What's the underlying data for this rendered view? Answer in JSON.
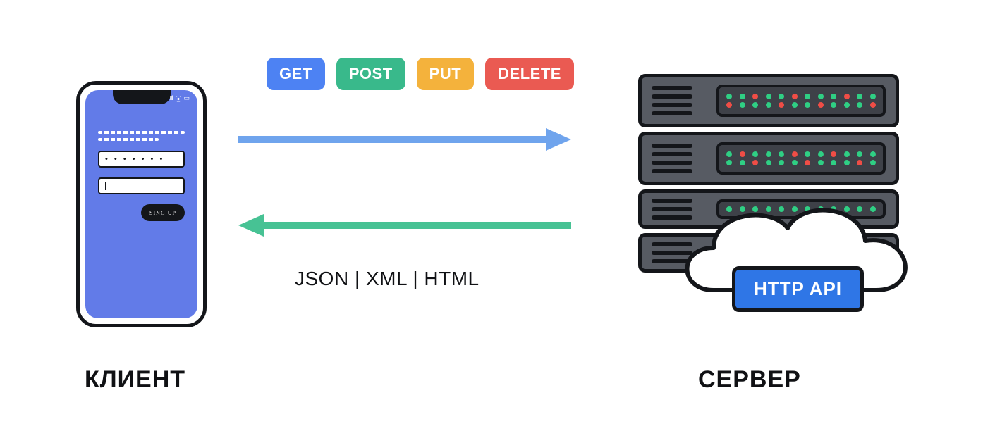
{
  "client": {
    "label": "КЛИЕНТ",
    "signup_button": "SING UP",
    "password_dots": "• • • • • • •"
  },
  "methods": {
    "get": "GET",
    "post": "POST",
    "put": "PUT",
    "delete": "DELETE"
  },
  "response_formats": "JSON | XML | HTML",
  "server": {
    "label": "СЕРВЕР",
    "api_badge": "HTTP API"
  },
  "colors": {
    "request_arrow": "#6fa4ed",
    "response_arrow": "#47c294",
    "get": "#4d82f3",
    "post": "#39b98b",
    "put": "#f4b23c",
    "delete": "#ea5a52",
    "api_badge": "#2f76e6",
    "phone_screen": "#627be8",
    "rack_body": "#575b63"
  }
}
